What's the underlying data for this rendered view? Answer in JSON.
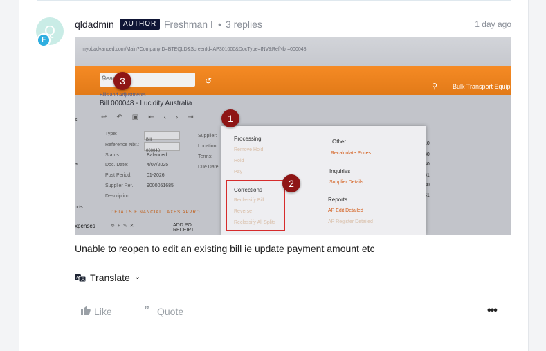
{
  "post": {
    "avatar_letter": "Q",
    "rank_letter": "F",
    "username": "qldadmin",
    "badge": "AUTHOR",
    "rank": "Freshman I",
    "separator": "•",
    "replies": "3 replies",
    "time": "1 day ago",
    "body": "Unable to reopen to edit an existing bill ie update payment amount etc"
  },
  "actions": {
    "translate": "Translate",
    "like": "Like",
    "quote": "Quote",
    "more": "•••"
  },
  "screenshot": {
    "url": "myobadvanced.com/Main?CompanyID=BTEQLD&ScreenId=AP301000&DocType=INV&RefNbr=000048",
    "search_placeholder": "Search",
    "company": "Bulk Transport Equip",
    "breadcrumb": "Bills and Adjustments",
    "title": "Bill 000048 - Lucidity Australia",
    "side_labels": [
      "s",
      "al",
      "orts",
      "xpenses"
    ],
    "form": {
      "type_label": "Type:",
      "type_value": "Bill",
      "ref_label": "Reference Nbr.:",
      "ref_value": "000048",
      "status_label": "Status:",
      "status_value": "Balanced",
      "date_label": "Doc. Date:",
      "date_value": "4/07/2025",
      "period_label": "Post Period:",
      "period_value": "01-2026",
      "supref_label": "Supplier Ref.:",
      "supref_value": "9000051685",
      "desc_label": "Description"
    },
    "form_right": [
      "Supplier:",
      "Location:",
      "Terms:",
      "Due Date:"
    ],
    "numbers": [
      "10",
      "30",
      "30",
      "51",
      "30",
      "51"
    ],
    "tabs": "DETAILS   FINANCIAL   TAXES   APPRO",
    "bottom_action": "ADD PO RECEIPT",
    "menu": {
      "processing": "Processing",
      "processing_items": [
        "Remove Hold",
        "Hold",
        "Pay"
      ],
      "corrections": "Corrections",
      "corrections_items": [
        "Reclassify Bill",
        "Reverse",
        "Reclassify All Splits"
      ],
      "other": "Other",
      "other_items": [
        "Recalculate Prices"
      ],
      "inquiries": "Inquiries",
      "inquiries_items": [
        "Supplier Details"
      ],
      "reports": "Reports",
      "reports_items": [
        "AP Edit Detailed",
        "AP Register Detailed"
      ]
    },
    "markers": [
      "1",
      "2",
      "3"
    ]
  }
}
